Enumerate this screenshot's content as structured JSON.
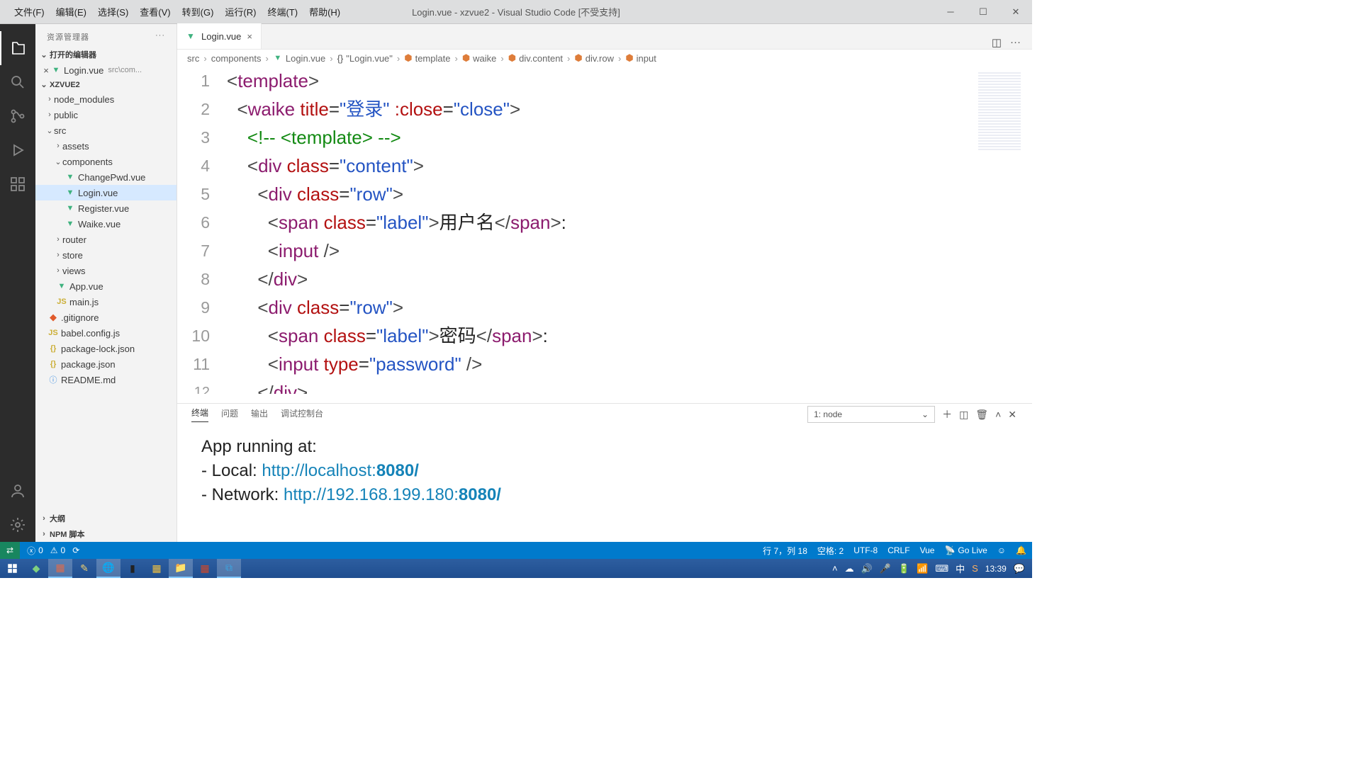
{
  "menu": {
    "file": "文件(F)",
    "edit": "编辑(E)",
    "select": "选择(S)",
    "view": "查看(V)",
    "goto": "转到(G)",
    "run": "运行(R)",
    "terminal": "终端(T)",
    "help": "帮助(H)"
  },
  "window_title": "Login.vue - xzvue2 - Visual Studio Code [不受支持]",
  "sidebar": {
    "title": "资源管理器",
    "open_editors": "打开的编辑器",
    "open_editor_item": "Login.vue",
    "open_editor_sub": "src\\com...",
    "project": "XZVUE2",
    "entries": {
      "node_modules": "node_modules",
      "public": "public",
      "src": "src",
      "assets": "assets",
      "components": "components",
      "ChangePwd": "ChangePwd.vue",
      "Login": "Login.vue",
      "Register": "Register.vue",
      "Waike": "Waike.vue",
      "router": "router",
      "store": "store",
      "views": "views",
      "App": "App.vue",
      "main": "main.js",
      "gitignore": ".gitignore",
      "babel": "babel.config.js",
      "pkglock": "package-lock.json",
      "pkg": "package.json",
      "readme": "README.md"
    },
    "outline": "大纲",
    "npm": "NPM 脚本"
  },
  "tab": {
    "name": "Login.vue"
  },
  "breadcrumbs": {
    "src": "src",
    "components": "components",
    "file": "Login.vue",
    "q": "\"Login.vue\"",
    "template": "template",
    "waike": "waike",
    "content": "div.content",
    "row": "div.row",
    "input": "input"
  },
  "code": {
    "l1": {
      "tag": "template"
    },
    "l2": {
      "tag": "waike",
      "a1": "title",
      "v1": "\"登录\"",
      "a2": ":close",
      "v2": "\"close\""
    },
    "l3": {
      "cmt": "<!-- <template> -->"
    },
    "l4": {
      "tag": "div",
      "a1": "class",
      "v1": "\"content\""
    },
    "l5": {
      "tag": "div",
      "a1": "class",
      "v1": "\"row\""
    },
    "l6": {
      "tag": "span",
      "a1": "class",
      "v1": "\"label\"",
      "txt": "用户名",
      "colon": ":"
    },
    "l7": {
      "tag": "input"
    },
    "l8": {
      "close": "div"
    },
    "l9": {
      "tag": "div",
      "a1": "class",
      "v1": "\"row\""
    },
    "l10": {
      "tag": "span",
      "a1": "class",
      "v1": "\"label\"",
      "txt": "密码",
      "colon": ":"
    },
    "l11": {
      "tag": "input",
      "a1": "type",
      "v1": "\"password\""
    },
    "l12": {
      "close": "div"
    }
  },
  "panel": {
    "tabs": {
      "terminal": "终端",
      "problems": "问题",
      "output": "输出",
      "debug": "调试控制台"
    },
    "selector": "1: node"
  },
  "terminal": {
    "l1": "App running at:",
    "l2a": "- Local:   ",
    "l2b": "http://localhost:",
    "l2c": "8080/",
    "l2d": "",
    "l3a": "- Network: ",
    "l3b": "http://192.168.199.180:",
    "l3c": "8080/",
    "l3d": ""
  },
  "status": {
    "errors": "0",
    "warnings": "0",
    "pos": "行 7，列 18",
    "spaces": "空格: 2",
    "enc": "UTF-8",
    "eol": "CRLF",
    "lang": "Vue",
    "golive": "Go Live"
  },
  "tray": {
    "time": "13:39"
  }
}
